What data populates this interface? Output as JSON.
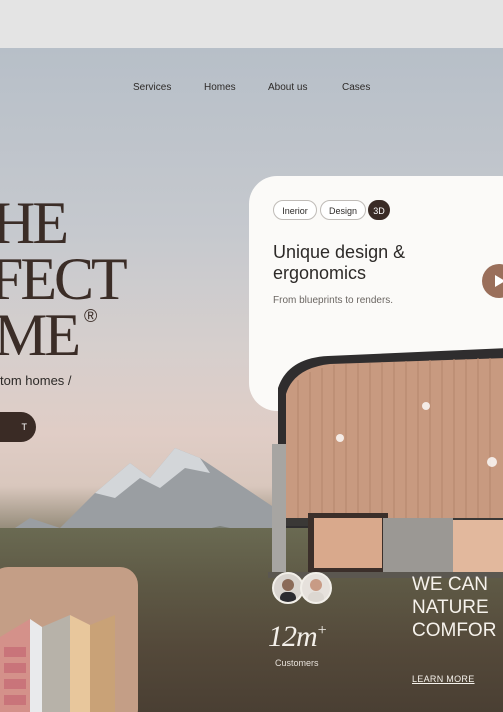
{
  "nav": {
    "items": [
      "Services",
      "Homes",
      "About us",
      "Cases"
    ]
  },
  "hero": {
    "title_line1": "HE",
    "title_line2": "FECT",
    "title_line3": "ME",
    "registered_mark": "®",
    "subtitle": "tom homes /",
    "cta_label": "T"
  },
  "card": {
    "tags": [
      "Inerior",
      "Design",
      "3D"
    ],
    "heading": "Unique design & ergonomics",
    "description": "From blueprints to renders."
  },
  "stats": {
    "value": "12m",
    "suffix": "+",
    "label": "Customers"
  },
  "promo": {
    "headline_lines": [
      "WE CAN",
      "NATURE",
      "COMFOR"
    ],
    "link_label": "LEARN MORE"
  },
  "colors": {
    "accent": "#3a2b25",
    "play": "#9a6f5b",
    "tile": "#c49e86"
  }
}
